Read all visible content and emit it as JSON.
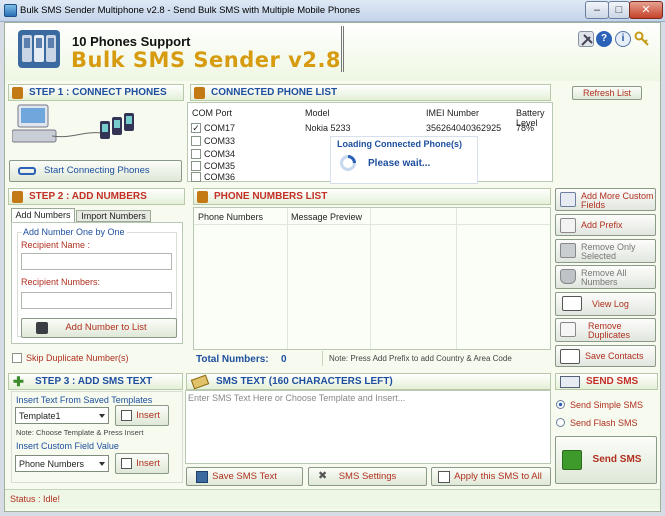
{
  "window": {
    "title": "Bulk SMS Sender Multiphone v2.8 - Send Bulk SMS with Multiple Mobile Phones",
    "min": "–",
    "max": "□",
    "close": "✕"
  },
  "header": {
    "line1": "10 Phones Support",
    "line2": "Bulk SMS Sender v2.8",
    "icons": [
      "tools-icon",
      "help-icon",
      "info-icon",
      "key-icon"
    ]
  },
  "step1": {
    "title": "STEP 1 : CONNECT PHONES",
    "start_button": "Start Connecting Phones"
  },
  "connected": {
    "title": "CONNECTED PHONE LIST",
    "refresh": "Refresh List",
    "columns": [
      "COM  Port",
      "Model",
      "IMEI Number",
      "Battery Level"
    ],
    "rows": [
      {
        "port": "COM17",
        "model": "Nokia 5233",
        "imei": "356264040362925",
        "battery": "78%",
        "checked": true
      },
      {
        "port": "COM33",
        "model": "",
        "imei": "",
        "battery": "",
        "checked": false
      },
      {
        "port": "COM34",
        "model": "",
        "imei": "",
        "battery": "",
        "checked": false
      },
      {
        "port": "COM35",
        "model": "",
        "imei": "",
        "battery": "",
        "checked": false
      },
      {
        "port": "COM36",
        "model": "",
        "imei": "",
        "battery": "",
        "checked": false
      }
    ],
    "loading_title": "Loading Connected Phone(s)",
    "loading_text": "Please wait..."
  },
  "step2": {
    "title": "STEP 2 : ADD NUMBERS",
    "tabs": [
      "Add Numbers",
      "Import Numbers"
    ],
    "group": "Add Number One by One",
    "recipient_name": "Recipient Name :",
    "recipient_numbers": "Recipient Numbers:",
    "add_button": "Add Number to List",
    "skip_dup": "Skip Duplicate Number(s)"
  },
  "numbers_list": {
    "title": "PHONE NUMBERS LIST",
    "columns": [
      "Phone Numbers",
      "Message Preview"
    ],
    "total_label": "Total Numbers:",
    "total_value": "0",
    "note": "Note: Press Add Prefix to add Country & Area Code"
  },
  "side_buttons": [
    "Add More Custom Fields",
    "Add Prefix",
    "Remove Only Selected",
    "Remove All Numbers",
    "View Log",
    "Remove Duplicates",
    "Save Contacts"
  ],
  "step3": {
    "title": "STEP 3 : ADD SMS TEXT",
    "template_label": "Insert Text From Saved Templates",
    "template_value": "Template1",
    "insert": "Insert",
    "note": "Note: Choose Template & Press Insert",
    "custom_label": "Insert Custom Field Value",
    "custom_value": "Phone Numbers"
  },
  "sms_text": {
    "title": "SMS TEXT (160 CHARACTERS LEFT)",
    "placeholder": "Enter SMS Text Here or Choose Template and Insert...",
    "save": "Save SMS Text",
    "settings": "SMS Settings",
    "apply": "Apply this SMS to All"
  },
  "send": {
    "title": "SEND SMS",
    "simple": "Send Simple SMS",
    "flash": "Send Flash SMS",
    "button": "Send SMS"
  },
  "status": {
    "label": "Status : Idle!"
  },
  "colors": {
    "accent_red": "#c23027",
    "accent_blue": "#1d4f9e",
    "logo_gold": "#d79b10"
  }
}
